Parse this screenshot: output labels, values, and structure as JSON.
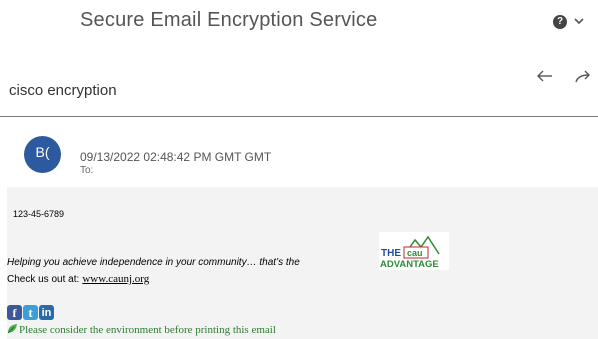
{
  "header": {
    "title": "Secure Email Encryption Service",
    "help_glyph": "?"
  },
  "message": {
    "subject": "cisco encryption",
    "avatar_initials": "B(",
    "sent_date": "09/13/2022 02:48:42 PM GMT GMT",
    "to_label": "To:"
  },
  "body": {
    "ssn": "123-45-6789",
    "tagline": "Helping you achieve independence in your community… that’s the",
    "logo_text_top": "THE",
    "logo_text_mid": "cau",
    "logo_text_bottom": "ADVANTAGE",
    "checkus_label": "Check us out at:",
    "website": "www.caunj.org",
    "social": {
      "facebook": "f",
      "twitter": "t",
      "linkedin": "in"
    },
    "environment_note": "Please consider the environment before printing this email"
  },
  "colors": {
    "avatar_bg": "#2d5a9e",
    "body_bg": "#f3f3f3",
    "green_note": "#2e7d32",
    "logo_green": "#2e8b3a",
    "logo_red": "#c62828",
    "logo_blue": "#1f4e9c"
  },
  "icons": {
    "help": "question-circle-icon",
    "chevron": "chevron-down-icon",
    "reply": "reply-arrow-icon",
    "forward": "forward-arrow-icon",
    "leaf": "leaf-icon"
  }
}
